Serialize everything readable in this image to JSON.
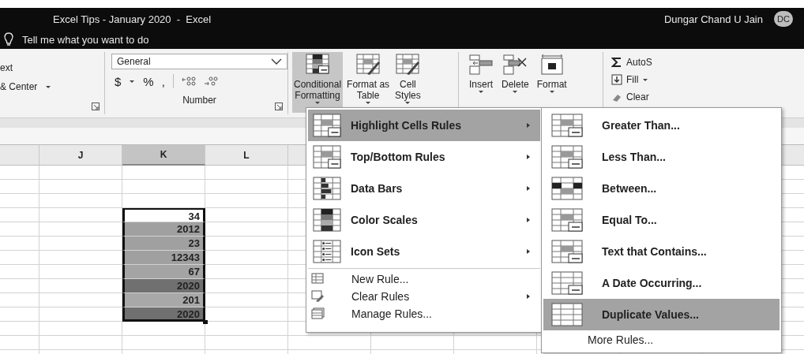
{
  "title_bar": {
    "title": "Excel Tips - January 2020  -  Excel",
    "user": "Dungar Chand U Jain",
    "avatar": "DC"
  },
  "tell_me": {
    "placeholder": "Tell me what you want to do"
  },
  "ribbon": {
    "alignment": {
      "wrap_text": "ext",
      "merge": "& Center"
    },
    "number": {
      "format": "General",
      "currency": "$",
      "percent": "%",
      "comma": ",",
      "group_label": "Number"
    },
    "styles": [
      {
        "label": "Conditional\nFormatting",
        "selected": true
      },
      {
        "label": "Format as\nTable",
        "selected": false
      },
      {
        "label": "Cell\nStyles",
        "selected": false
      }
    ],
    "cells": [
      {
        "label": "Insert"
      },
      {
        "label": "Delete"
      },
      {
        "label": "Format"
      }
    ],
    "editing": [
      {
        "label": "AutoS",
        "kind": "sum"
      },
      {
        "label": "Fill",
        "kind": "fill"
      },
      {
        "label": "Clear",
        "kind": "clear"
      }
    ]
  },
  "sheet": {
    "columns": [
      {
        "label": "J",
        "selected": false
      },
      {
        "label": "K",
        "selected": true
      },
      {
        "label": "L",
        "selected": false
      }
    ],
    "selected_cells": [
      {
        "value": "34",
        "color": "#ffffff"
      },
      {
        "value": "2012",
        "color": "#a0a0a0"
      },
      {
        "value": "23",
        "color": "#a0a0a0"
      },
      {
        "value": "12343",
        "color": "#a0a0a0"
      },
      {
        "value": "67",
        "color": "#a4a4a4"
      },
      {
        "value": "2020",
        "color": "#707070"
      },
      {
        "value": "201",
        "color": "#a8a8a8"
      },
      {
        "value": "2020",
        "color": "#707070"
      }
    ]
  },
  "menu": {
    "items": [
      {
        "label": "Highlight Cells Rules",
        "kind": "large",
        "selected": true,
        "submenu": true
      },
      {
        "label": "Top/Bottom Rules",
        "kind": "large",
        "selected": false,
        "submenu": true
      },
      {
        "label": "Data Bars",
        "kind": "large",
        "selected": false,
        "submenu": true
      },
      {
        "label": "Color Scales",
        "kind": "large",
        "selected": false,
        "submenu": true
      },
      {
        "label": "Icon Sets",
        "kind": "large",
        "selected": false,
        "submenu": true
      },
      {
        "label": "New Rule...",
        "kind": "small",
        "selected": false,
        "submenu": false
      },
      {
        "label": "Clear Rules",
        "kind": "small",
        "selected": false,
        "submenu": true
      },
      {
        "label": "Manage Rules...",
        "kind": "small",
        "selected": false,
        "submenu": false
      }
    ]
  },
  "submenu": {
    "items": [
      {
        "label": "Greater Than...",
        "kind": "large",
        "selected": false
      },
      {
        "label": "Less Than...",
        "kind": "large",
        "selected": false
      },
      {
        "label": "Between...",
        "kind": "large",
        "selected": false
      },
      {
        "label": "Equal To...",
        "kind": "large",
        "selected": false
      },
      {
        "label": "Text that Contains...",
        "kind": "large",
        "selected": false
      },
      {
        "label": "A Date Occurring...",
        "kind": "large",
        "selected": false
      },
      {
        "label": "Duplicate Values...",
        "kind": "large",
        "selected": true
      },
      {
        "label": "More Rules...",
        "kind": "footer",
        "selected": false
      }
    ]
  }
}
